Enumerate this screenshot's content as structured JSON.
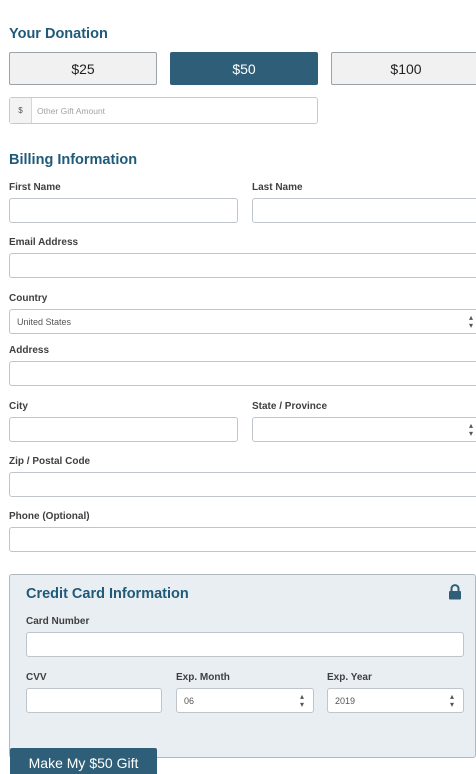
{
  "donation": {
    "title": "Your Donation",
    "amounts": [
      "$25",
      "$50",
      "$100"
    ],
    "selected": "$50",
    "other": {
      "prefix": "$",
      "placeholder": "Other Gift Amount"
    }
  },
  "billing": {
    "title": "Billing Information",
    "first_name_label": "First Name",
    "last_name_label": "Last Name",
    "email_label": "Email Address",
    "country_label": "Country",
    "country_value": "United States",
    "address_label": "Address",
    "city_label": "City",
    "state_label": "State / Province",
    "zip_label": "Zip / Postal Code",
    "phone_label": "Phone (Optional)"
  },
  "card": {
    "title": "Credit Card Information",
    "number_label": "Card Number",
    "cvv_label": "CVV",
    "exp_month_label": "Exp. Month",
    "exp_month_value": "06",
    "exp_year_label": "Exp. Year",
    "exp_year_value": "2019"
  },
  "submit_label": "Make My $50 Gift",
  "colors": {
    "accent": "#2f5f78",
    "heading": "#1f5a78",
    "panel": "#e9eef3"
  },
  "icons": {
    "lock": "lock-icon",
    "select_arrows": "sort-arrows-icon"
  }
}
